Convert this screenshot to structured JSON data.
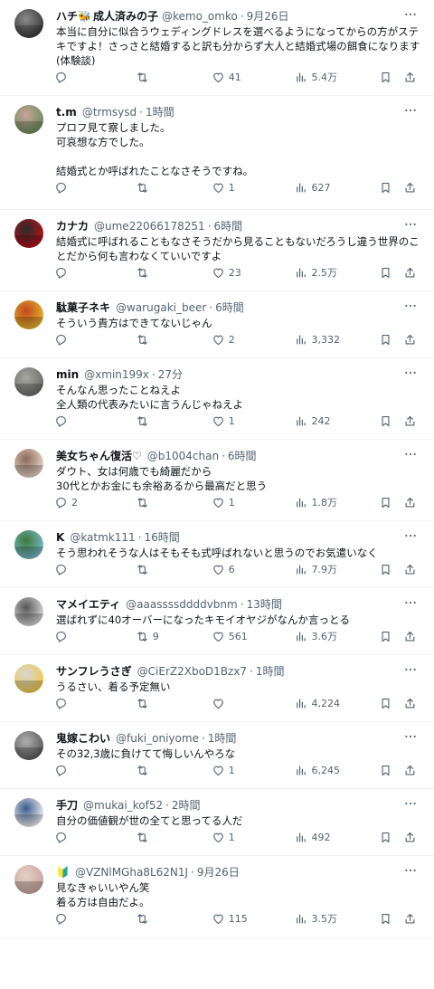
{
  "tweets": [
    {
      "name": "ハチ",
      "name_suffix": "成人済みの子",
      "badge": "🐝",
      "handle": "@kemo_omko",
      "time": "9月26日",
      "text": "本当に自分に似合うウェディングドレスを選べるようになってからの方がステキですよ！さっさと結婚すると訳も分からず大人と結婚式場の餌食になります(体験談)",
      "replies": "",
      "retweets": "",
      "likes": "41",
      "views": "5.4万",
      "avatar_colors": [
        "#3a3a3a",
        "#8a8a8a"
      ],
      "pad_bottom": 10
    },
    {
      "name": "t.m",
      "handle": "@trmsysd",
      "time": "1時間",
      "text": "プロフ見て察しました。\n可哀想な方でした。\n\n結婚式とか呼ばれたことなさそうですね。",
      "replies": "",
      "retweets": "",
      "likes": "1",
      "views": "627",
      "avatar_colors": [
        "#6b8f5a",
        "#c9a39b"
      ],
      "pad_bottom": 14
    },
    {
      "name": "カナカ",
      "handle": "@ume22066178251",
      "time": "6時間",
      "text": "結婚式に呼ばれることもなさそうだから見ることもないだろうし違う世界のことだから何も言わなくていいですよ",
      "replies": "",
      "retweets": "",
      "likes": "23",
      "views": "2.5万",
      "avatar_colors": [
        "#b3121b",
        "#2b2b2b"
      ],
      "pad_bottom": 10
    },
    {
      "name": "駄菓子ネキ",
      "handle": "@warugaki_beer",
      "time": "6時間",
      "text": "そういう貴方はできてないじゃん",
      "replies": "",
      "retweets": "",
      "likes": "2",
      "views": "3,332",
      "avatar_colors": [
        "#e2b52b",
        "#c2461d"
      ],
      "pad_bottom": 10
    },
    {
      "name": "min",
      "handle": "@xmin199x",
      "time": "27分",
      "text": "そんなん思ったことねえよ\n全人類の代表みたいに言うんじゃねえよ",
      "replies": "",
      "retweets": "",
      "likes": "1",
      "views": "242",
      "avatar_colors": [
        "#6b6b6b",
        "#a8a8a0"
      ],
      "pad_bottom": 10
    },
    {
      "name": "美女ちゃん復活♡",
      "handle": "@b1004chan",
      "time": "6時間",
      "text": "ダウト、女は何歳でも綺麗だから\n30代とかお金にも余裕あるから最高だと思う",
      "replies": "2",
      "retweets": "",
      "likes": "1",
      "views": "1.8万",
      "avatar_colors": [
        "#e9d5c8",
        "#8a6a5a"
      ],
      "pad_bottom": 10
    },
    {
      "name": "K",
      "handle": "@katmk111",
      "time": "16時間",
      "text": "そう思われそうな人はそもそも式呼ばれないと思うのでお気遣いなく",
      "replies": "",
      "retweets": "",
      "likes": "6",
      "views": "7.9万",
      "avatar_colors": [
        "#7bb8c9",
        "#3c7a3a"
      ],
      "pad_bottom": 10
    },
    {
      "name": "マメイエティ",
      "handle": "@aaassssddddvbnm",
      "time": "13時間",
      "text": "選ばれずに40オーバーになったキモイオヤジがなんか言っとる",
      "replies": "",
      "retweets": "9",
      "likes": "561",
      "views": "3.6万",
      "avatar_colors": [
        "#d8d8d8",
        "#555555"
      ],
      "pad_bottom": 10
    },
    {
      "name": "サンフレうさぎ",
      "handle": "@CiErZ2XboD1Bzx7",
      "time": "1時間",
      "text": "うるさい、着る予定無い",
      "replies": "",
      "retweets": "",
      "likes": "",
      "views": "4,224",
      "avatar_colors": [
        "#f2c94c",
        "#d6d6d6"
      ],
      "pad_bottom": 10
    },
    {
      "name": "鬼嫁こわい",
      "handle": "@fuki_oniyome",
      "time": "1時間",
      "text": "その32,3歳に負けてて悔しいんやろな",
      "replies": "",
      "retweets": "",
      "likes": "1",
      "views": "6,245",
      "avatar_colors": [
        "#5a5a5a",
        "#b0b0b0"
      ],
      "pad_bottom": 10
    },
    {
      "name": "手刀",
      "handle": "@mukai_kof52",
      "time": "2時間",
      "text": "自分の価値観が世の全てと思ってる人だ",
      "replies": "",
      "retweets": "",
      "likes": "1",
      "views": "492",
      "avatar_colors": [
        "#f2f2f2",
        "#3a5a8a"
      ],
      "pad_bottom": 10
    },
    {
      "name": "",
      "badge": "🔰",
      "handle": "@VZNlMGha8L62N1J",
      "time": "9月26日",
      "text": "見なきゃいいやん笑\n着る方は自由だよ。",
      "replies": "",
      "retweets": "",
      "likes": "115",
      "views": "3.5万",
      "avatar_colors": [
        "#c9a6a0",
        "#e6d0c8"
      ],
      "pad_bottom": 12
    }
  ]
}
